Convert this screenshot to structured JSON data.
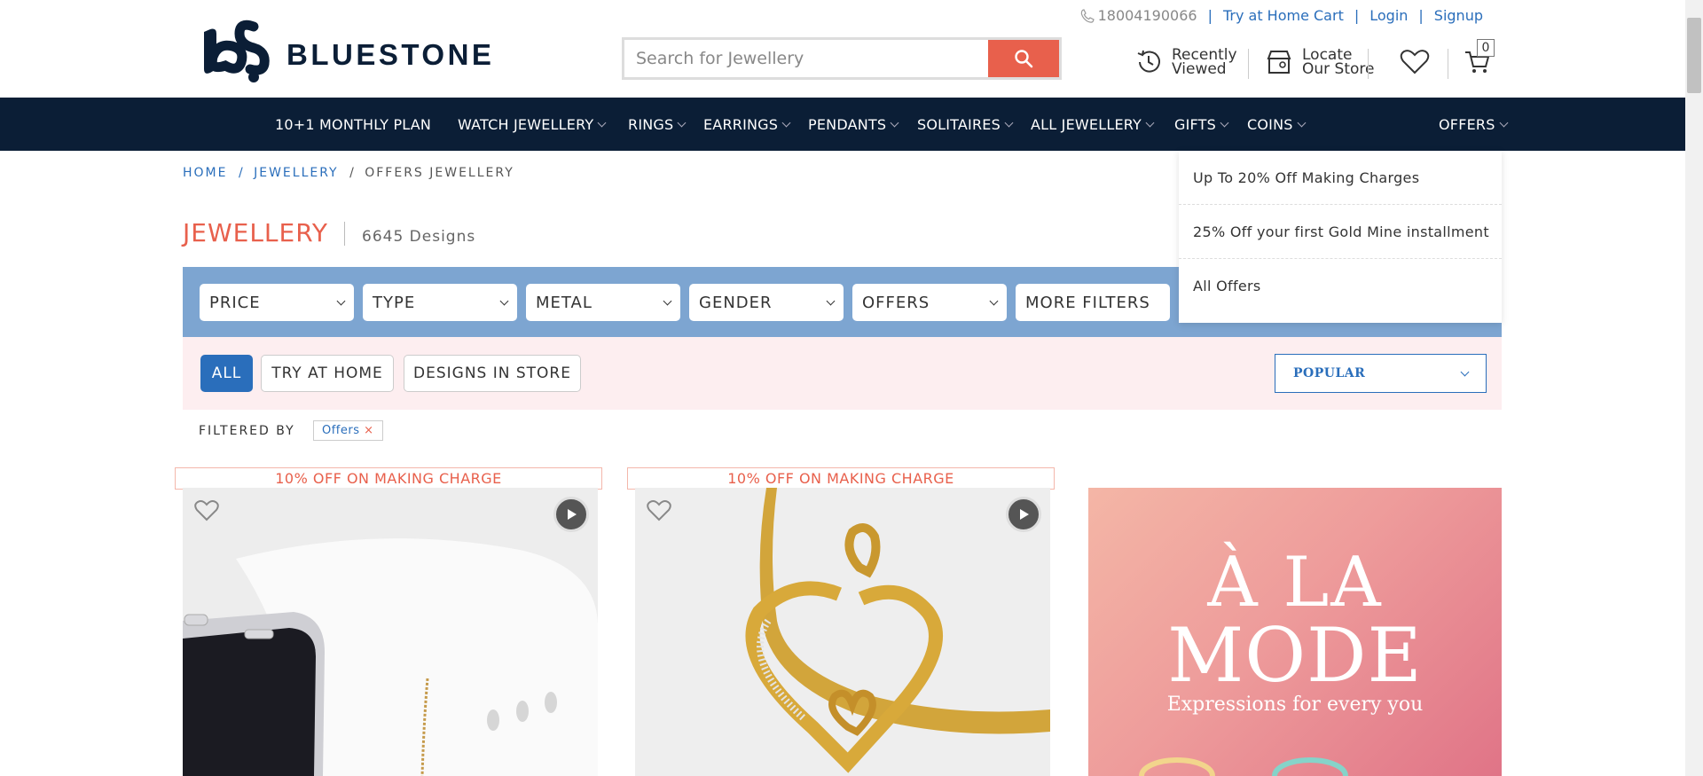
{
  "brand": {
    "name": "BLUESTONE",
    "monogram": "bs"
  },
  "toplinks": {
    "phone": "18004190066",
    "try_home": "Try at Home Cart",
    "login": "Login",
    "signup": "Signup"
  },
  "search": {
    "placeholder": "Search for Jewellery"
  },
  "util": {
    "recent_l1": "Recently",
    "recent_l2": "Viewed",
    "locate_l1": "Locate",
    "locate_l2": "Our Store",
    "cart_count": "0"
  },
  "nav": [
    "10+1 MONTHLY PLAN",
    "WATCH JEWELLERY",
    "RINGS",
    "EARRINGS",
    "PENDANTS",
    "SOLITAIRES",
    "ALL JEWELLERY",
    "GIFTS",
    "COINS",
    "OFFERS"
  ],
  "breadcrumb": {
    "home": "HOME",
    "jewellery": "JEWELLERY",
    "current": "OFFERS JEWELLERY",
    "sep": "/"
  },
  "heading": {
    "title": "JEWELLERY",
    "count": "6645 Designs"
  },
  "filters": [
    "PRICE",
    "TYPE",
    "METAL",
    "GENDER",
    "OFFERS",
    "MORE FILTERS"
  ],
  "views": {
    "all": "ALL",
    "try_home": "TRY AT HOME",
    "in_store": "DESIGNS IN STORE"
  },
  "sort": {
    "value": "POPULAR"
  },
  "filtered_by": {
    "label": "FILTERED BY",
    "chip": "Offers",
    "chip_x": "×"
  },
  "offers_menu": [
    "Up To 20% Off Making Charges",
    "25% Off your first Gold Mine installment",
    "All Offers"
  ],
  "products": [
    {
      "ribbon": "10% OFF ON MAKING CHARGE"
    },
    {
      "ribbon": "10% OFF ON MAKING CHARGE"
    }
  ],
  "promo": {
    "line1": "À LA",
    "line2": "MODE",
    "line3": "Expressions for every you"
  },
  "colors": {
    "navy": "#0b1e36",
    "accent": "#e8604c",
    "blue": "#2a6ebb",
    "filter_bar": "#7da5d1",
    "pink": "#fdeef0"
  }
}
